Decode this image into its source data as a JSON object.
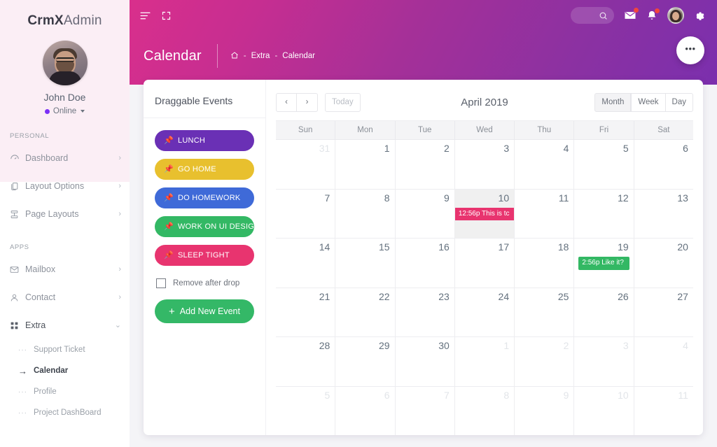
{
  "brand": {
    "bold": "CrmX",
    "light": "Admin"
  },
  "profile": {
    "name": "John Doe",
    "status": "Online"
  },
  "sidebar": {
    "sections": [
      {
        "label": "PERSONAL"
      },
      {
        "label": "APPS"
      }
    ],
    "personal_items": [
      {
        "label": "Dashboard",
        "icon": "dashboard-icon",
        "arrow": "›"
      },
      {
        "label": "Layout Options",
        "icon": "layers-icon",
        "arrow": "›"
      },
      {
        "label": "Page Layouts",
        "icon": "page-layout-icon",
        "arrow": "›"
      }
    ],
    "apps_items": [
      {
        "label": "Mailbox",
        "icon": "mail-icon",
        "arrow": "›"
      },
      {
        "label": "Contact",
        "icon": "user-icon",
        "arrow": "›"
      },
      {
        "label": "Extra",
        "icon": "grid-icon",
        "arrow": "⌄"
      }
    ],
    "extra_children": [
      {
        "label": "Support Ticket",
        "marker": "···",
        "active": false
      },
      {
        "label": "Calendar",
        "marker": "→",
        "active": true
      },
      {
        "label": "Profile",
        "marker": "···",
        "active": false
      },
      {
        "label": "Project DashBoard",
        "marker": "···",
        "active": false
      }
    ]
  },
  "topbar": {
    "menu_icon": "hamburger-icon",
    "fullscreen_icon": "fullscreen-icon",
    "search_icon": "search-icon",
    "mail_icon": "envelope-icon",
    "bell_icon": "bell-icon",
    "settings_icon": "gear-icon",
    "avatar": "user-avatar"
  },
  "page": {
    "title": "Calendar",
    "breadcrumb": {
      "home_icon": "home-icon",
      "sep": "-",
      "items": [
        "Extra",
        "Calendar"
      ]
    },
    "fab_label": "•••"
  },
  "draggable": {
    "title": "Draggable Events",
    "events": [
      {
        "label": "LUNCH",
        "color": "#6a30b5",
        "icon": "pin-icon"
      },
      {
        "label": "GO HOME",
        "color": "#e8c02e",
        "icon": "pin-icon"
      },
      {
        "label": "DO HOMEWORK",
        "color": "#3f6ad8",
        "icon": "pin-icon"
      },
      {
        "label": "WORK ON UI DESIGN",
        "color": "#33b864",
        "icon": "pin-icon"
      },
      {
        "label": "SLEEP TIGHT",
        "color": "#e8346f",
        "icon": "pin-icon"
      }
    ],
    "checkbox_label": "Remove after drop",
    "checkbox_checked": false,
    "add_button": "Add New Event",
    "add_button_plus": "+"
  },
  "calendar": {
    "prev_label": "‹",
    "next_label": "›",
    "today_label": "Today",
    "title": "April 2019",
    "views": [
      {
        "label": "Month",
        "active": true
      },
      {
        "label": "Week",
        "active": false
      },
      {
        "label": "Day",
        "active": false
      }
    ],
    "day_headers": [
      "Sun",
      "Mon",
      "Tue",
      "Wed",
      "Thu",
      "Fri",
      "Sat"
    ],
    "weeks": [
      [
        {
          "day": "31",
          "other": true
        },
        {
          "day": "1"
        },
        {
          "day": "2"
        },
        {
          "day": "3"
        },
        {
          "day": "4"
        },
        {
          "day": "5"
        },
        {
          "day": "6"
        }
      ],
      [
        {
          "day": "7"
        },
        {
          "day": "8"
        },
        {
          "day": "9"
        },
        {
          "day": "10",
          "today": true,
          "events": [
            {
              "time": "12:56p",
              "text": "This is tc",
              "color": "pink"
            }
          ]
        },
        {
          "day": "11"
        },
        {
          "day": "12"
        },
        {
          "day": "13"
        }
      ],
      [
        {
          "day": "14"
        },
        {
          "day": "15"
        },
        {
          "day": "16"
        },
        {
          "day": "17"
        },
        {
          "day": "18"
        },
        {
          "day": "19",
          "events": [
            {
              "time": "2:56p",
              "text": "Like it?",
              "color": "green"
            }
          ]
        },
        {
          "day": "20"
        }
      ],
      [
        {
          "day": "21"
        },
        {
          "day": "22"
        },
        {
          "day": "23"
        },
        {
          "day": "24"
        },
        {
          "day": "25"
        },
        {
          "day": "26"
        },
        {
          "day": "27"
        }
      ],
      [
        {
          "day": "28"
        },
        {
          "day": "29"
        },
        {
          "day": "30"
        },
        {
          "day": "1",
          "other": true
        },
        {
          "day": "2",
          "other": true
        },
        {
          "day": "3",
          "other": true
        },
        {
          "day": "4",
          "other": true
        }
      ],
      [
        {
          "day": "5",
          "other": true
        },
        {
          "day": "6",
          "other": true
        },
        {
          "day": "7",
          "other": true
        },
        {
          "day": "8",
          "other": true
        },
        {
          "day": "9",
          "other": true
        },
        {
          "day": "10",
          "other": true
        },
        {
          "day": "11",
          "other": true
        }
      ]
    ]
  },
  "colors": {
    "header_gradient_start": "#d92f8c",
    "header_gradient_end": "#7530b5",
    "sidebar_tint": "#fbeef5",
    "accent_green": "#34b867",
    "accent_pink": "#e8346f"
  }
}
